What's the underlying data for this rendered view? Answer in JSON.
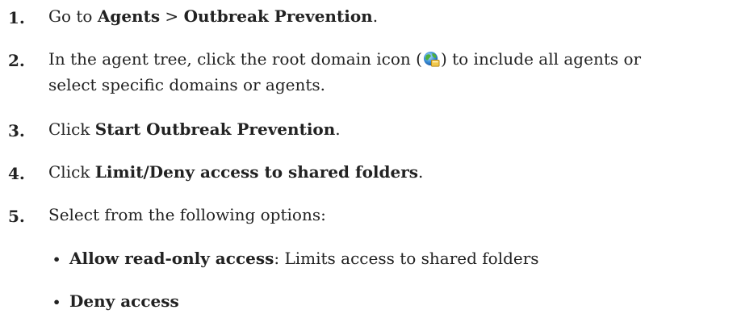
{
  "steps": [
    {
      "number": "1.",
      "prefix": "Go to ",
      "bold1": "Agents",
      "middle": " > ",
      "bold2": "Outbreak Prevention",
      "suffix": "."
    },
    {
      "number": "2.",
      "before_icon": "In the agent tree, click the root domain icon (",
      "icon": "root-domain-globe-icon",
      "after_icon": ") to include all agents or",
      "line2": "select specific domains or agents."
    },
    {
      "number": "3.",
      "prefix": "Click ",
      "bold": "Start Outbreak Prevention",
      "suffix": "."
    },
    {
      "number": "4.",
      "prefix": "Click ",
      "bold": "Limit/Deny access to shared folders",
      "suffix": "."
    },
    {
      "number": "5.",
      "text": "Select from the following options:"
    }
  ],
  "options": [
    {
      "bullet": "•",
      "bold": "Allow read-only access",
      "rest": ": Limits access to shared folders"
    },
    {
      "bullet": "•",
      "bold": "Deny access",
      "rest": ""
    }
  ]
}
